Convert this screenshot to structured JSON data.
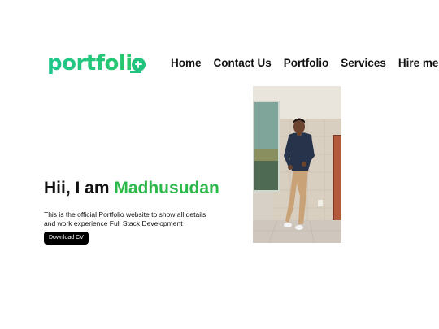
{
  "logo": {
    "text": "portfoli",
    "accent_color": "#21c47f"
  },
  "nav": {
    "items": [
      {
        "label": "Home"
      },
      {
        "label": "Contact Us"
      },
      {
        "label": "Portfolio"
      },
      {
        "label": "Services"
      },
      {
        "label": "Hire me"
      }
    ]
  },
  "hero": {
    "greeting": "Hii, I am ",
    "name": "Madhusudan",
    "name_color": "#2cb84a",
    "description": "This is the official Portfolio website to show all details and work experience Full Stack Development",
    "cv_button_label": "Download CV"
  },
  "photo": {
    "subject": "person-leaning-on-wall-icon"
  }
}
